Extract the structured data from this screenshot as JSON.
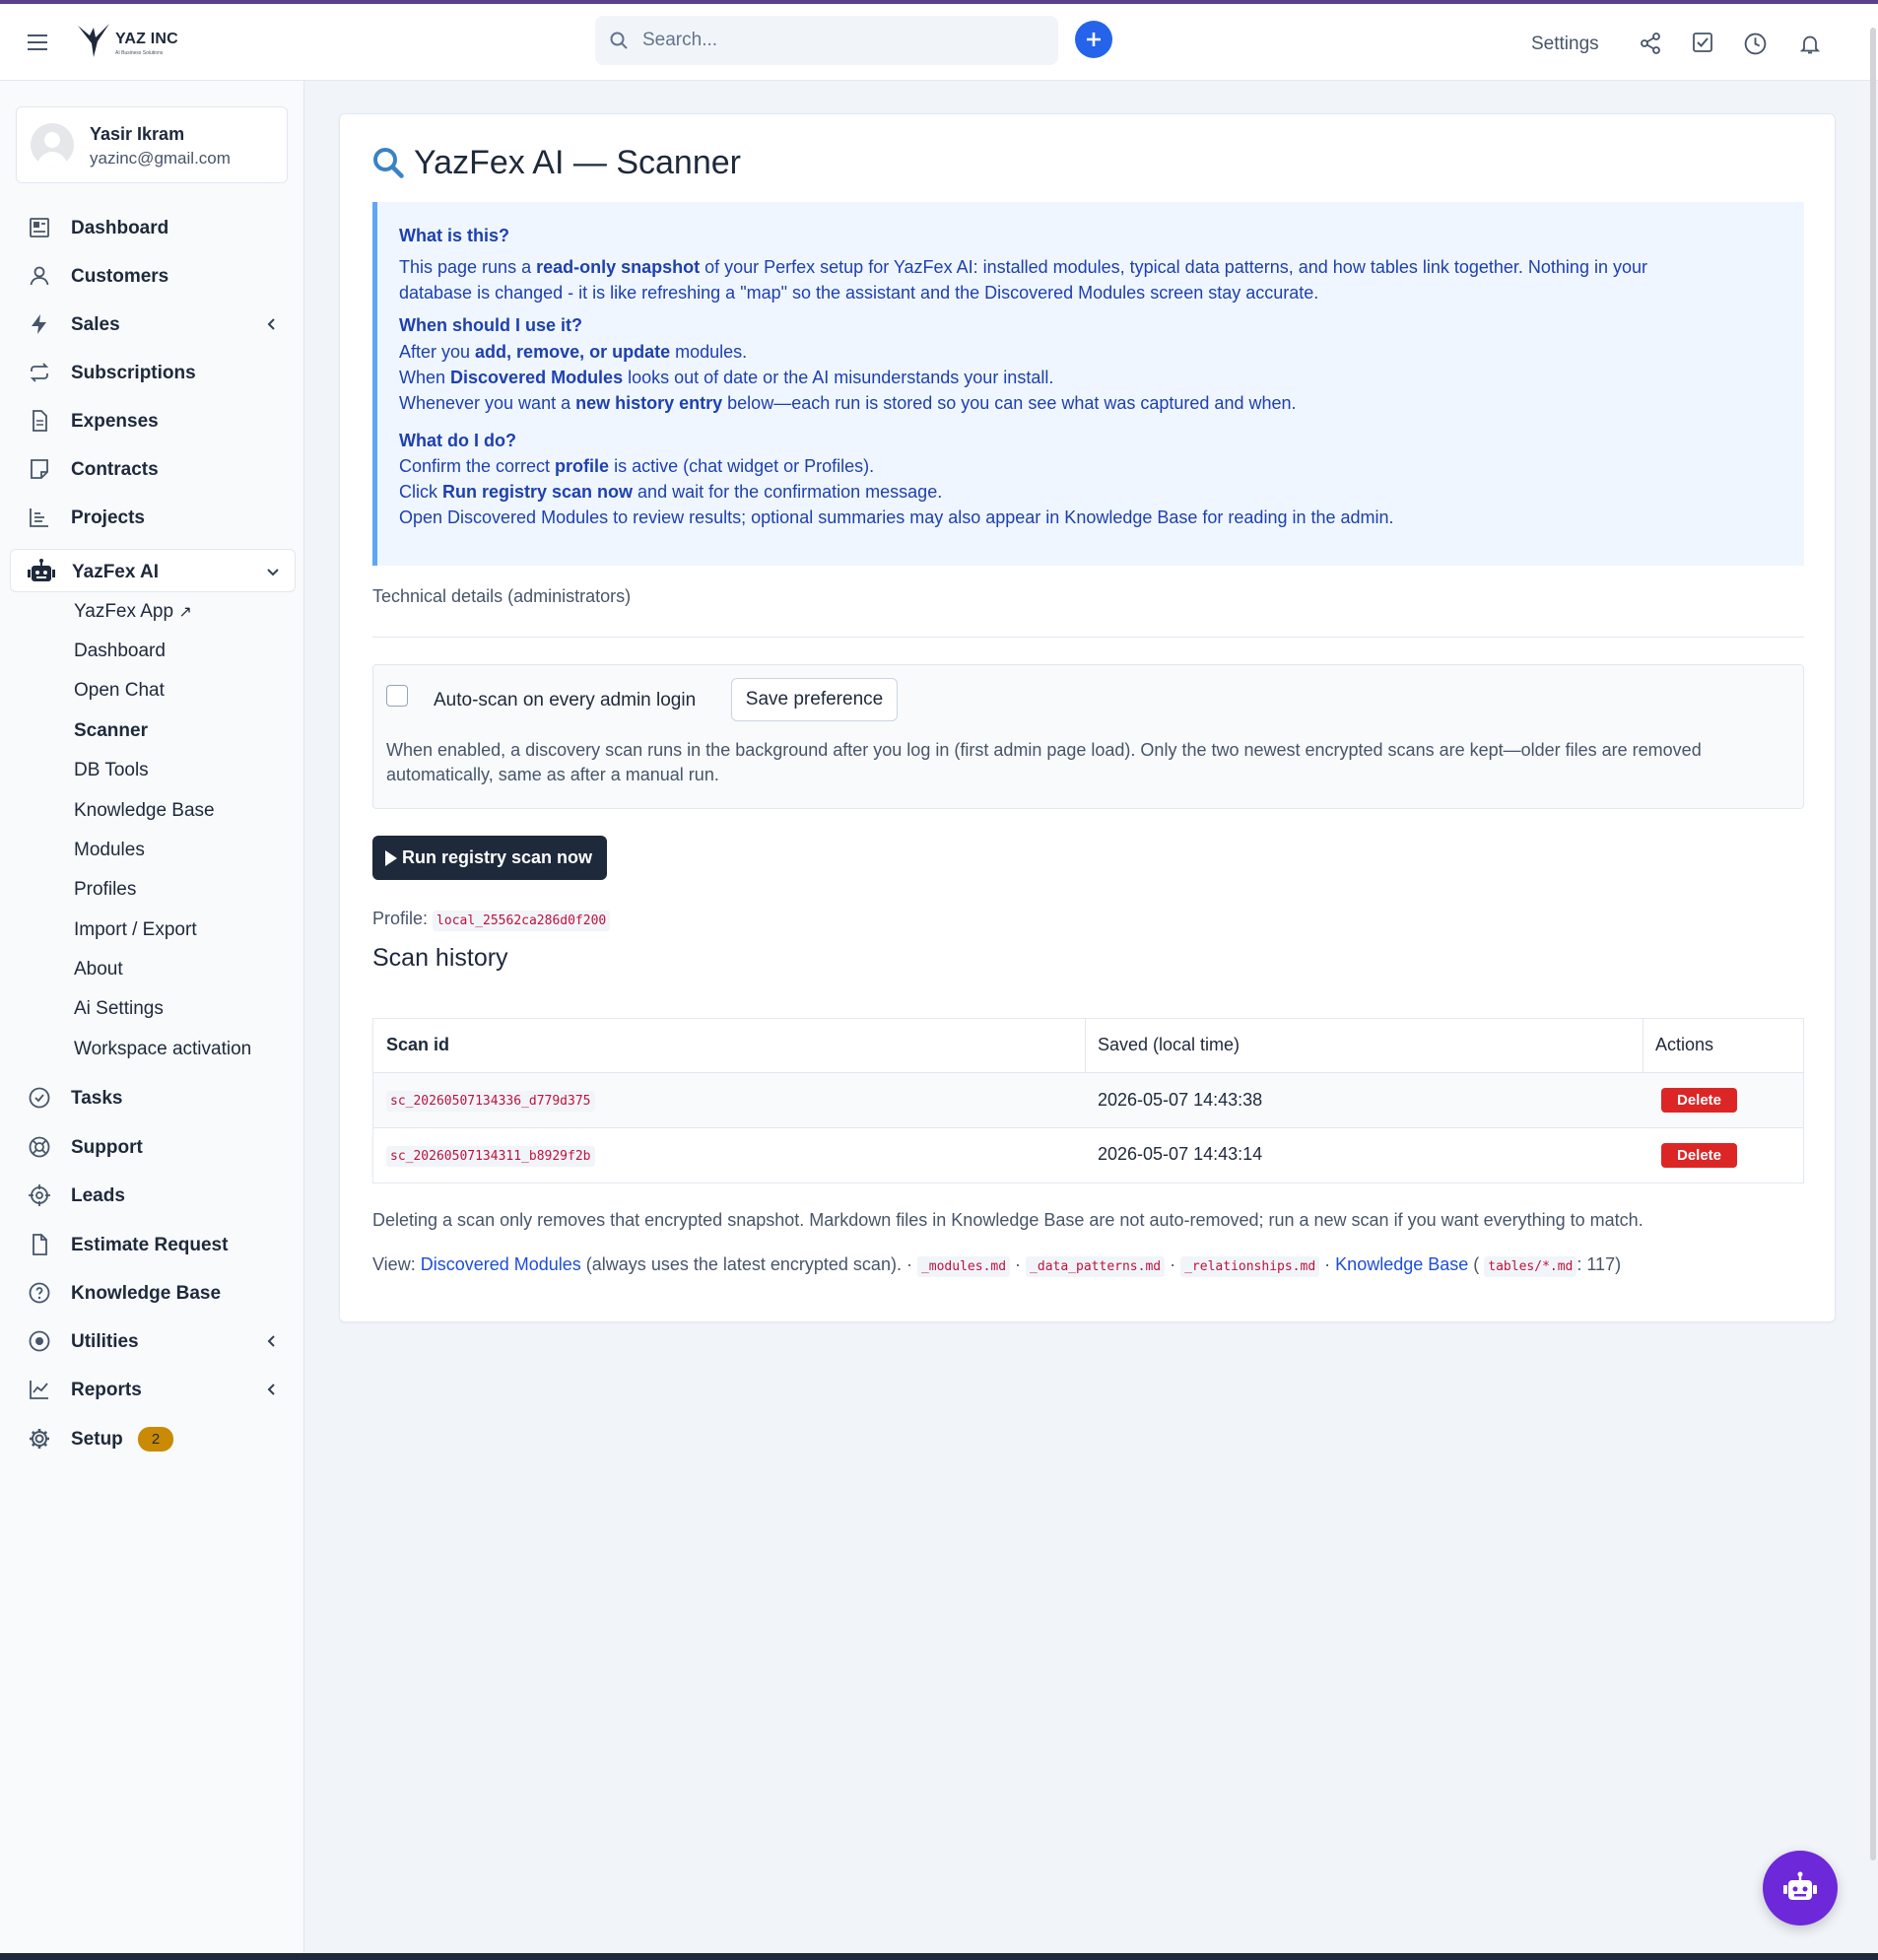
{
  "brand": {
    "name": "YAZ INC",
    "tagline": "AI Business Solutions"
  },
  "header": {
    "search_placeholder": "Search...",
    "settings_label": "Settings"
  },
  "user": {
    "name": "Yasir Ikram",
    "email": "yazinc@gmail.com"
  },
  "sidebar": {
    "items": [
      {
        "label": "Dashboard",
        "icon": "dashboard-icon"
      },
      {
        "label": "Customers",
        "icon": "user-icon"
      },
      {
        "label": "Sales",
        "icon": "bolt-icon"
      },
      {
        "label": "Subscriptions",
        "icon": "repeat-icon"
      },
      {
        "label": "Expenses",
        "icon": "document-icon"
      },
      {
        "label": "Contracts",
        "icon": "contract-icon"
      },
      {
        "label": "Projects",
        "icon": "chart-icon"
      },
      {
        "label": "YazFex AI",
        "icon": "robot-icon"
      },
      {
        "label": "Tasks",
        "icon": "check-circle-icon"
      },
      {
        "label": "Support",
        "icon": "lifebuoy-icon"
      },
      {
        "label": "Leads",
        "icon": "crosshair-icon"
      },
      {
        "label": "Estimate Request",
        "icon": "file-icon"
      },
      {
        "label": "Knowledge Base",
        "icon": "question-icon"
      },
      {
        "label": "Utilities",
        "icon": "target-icon"
      },
      {
        "label": "Reports",
        "icon": "line-chart-icon"
      },
      {
        "label": "Setup",
        "icon": "gear-icon"
      }
    ],
    "setup_badge": "2",
    "yazfex_sub": [
      "YazFex App",
      "Dashboard",
      "Open Chat",
      "Scanner",
      "DB Tools",
      "Knowledge Base",
      "Modules",
      "Profiles",
      "Import / Export",
      "About",
      "Ai Settings",
      "Workspace activation"
    ]
  },
  "page": {
    "title": "YazFex AI — Scanner",
    "info": {
      "q1": "What is this?",
      "p1_a": "This page runs a ",
      "p1_b": "read-only snapshot",
      "p1_c": " of your Perfex setup for YazFex AI: installed modules, typical data patterns, and how tables link together. Nothing in your",
      "p1_d": "database is changed - it is like refreshing a \"map\" so the assistant and the Discovered Modules screen stay accurate.",
      "q2": "When should I use it?",
      "l2_1a": "After you ",
      "l2_1b": "add, remove, or update",
      "l2_1c": " modules.",
      "l2_2a": "When ",
      "l2_2b": "Discovered Modules",
      "l2_2c": " looks out of date or the AI misunderstands your install.",
      "l2_3a": "Whenever you want a ",
      "l2_3b": "new history entry",
      "l2_3c": " below—each run is stored so you can see what was captured and when.",
      "q3": "What do I do?",
      "l3_1a": "Confirm the correct ",
      "l3_1b": "profile",
      "l3_1c": " is active (chat widget or Profiles).",
      "l3_2a": "Click ",
      "l3_2b": "Run registry scan now",
      "l3_2c": " and wait for the confirmation message.",
      "l3_3": "Open Discovered Modules to review results; optional summaries may also appear in Knowledge Base for reading in the admin."
    },
    "technical_details": "Technical details (administrators)",
    "autoscan": {
      "label": "Auto-scan on every admin login",
      "checked": false,
      "save_label": "Save preference",
      "description": "When enabled, a discovery scan runs in the background after you log in (first admin page load). Only the two newest encrypted scans are kept—older files are removed automatically, same as after a manual run."
    },
    "run_button": "Run registry scan now",
    "profile_label": "Profile:",
    "profile_id": "local_25562ca286d0f200",
    "history_title": "Scan history",
    "table": {
      "headers": [
        "Scan id",
        "Saved (local time)",
        "Actions"
      ],
      "rows": [
        {
          "id": "sc_20260507134336_d779d375",
          "saved": "2026-05-07 14:43:38",
          "action": "Delete"
        },
        {
          "id": "sc_20260507134311_b8929f2b",
          "saved": "2026-05-07 14:43:14",
          "action": "Delete"
        }
      ]
    },
    "note_delete": "Deleting a scan only removes that encrypted snapshot. Markdown files in Knowledge Base are not auto-removed; run a new scan if you want everything to match.",
    "view": {
      "prefix": "View:",
      "discovered": "Discovered Modules",
      "discovered_note": " (always uses the latest encrypted scan). · ",
      "file1": "_modules.md",
      "sep": " · ",
      "file2": "_data_patterns.md",
      "file3": "_relationships.md",
      "kb": "Knowledge Base",
      "open": " ( ",
      "file4": "tables/*.md",
      "count": ": 117)"
    }
  },
  "colors": {
    "accent": "#2563eb",
    "info_bg": "#eff6ff",
    "info_text": "#1e40af",
    "danger": "#dc2626",
    "fab": "#6d28d9",
    "dark_button": "#1e293b",
    "badge": "#ca8a04"
  }
}
